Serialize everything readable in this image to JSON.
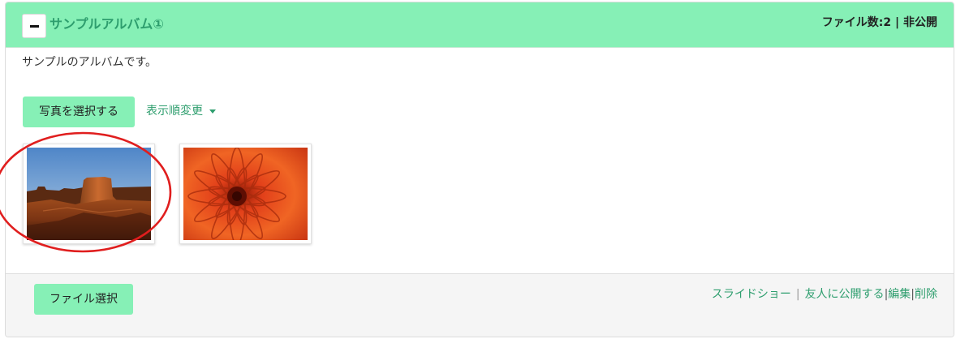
{
  "album": {
    "toggle_icon": "minus-icon",
    "title": "サンプルアルバム①",
    "meta": "ファイル数:2 | 非公開",
    "description": "サンプルのアルバムです。"
  },
  "toolbar": {
    "select_photo_label": "写真を選択する",
    "sort_label": "表示順変更",
    "sort_icon": "caret-down-icon"
  },
  "thumbnails": [
    {
      "subject": "desert-butte-landscape"
    },
    {
      "subject": "orange-chrysanthemum-flower"
    }
  ],
  "footer": {
    "file_select_label": "ファイル選択",
    "slideshow_label": "スライドショー",
    "separator_light": "|",
    "share_label": "友人に公開する",
    "separator": "|",
    "edit_label": "編集",
    "delete_label": "削除"
  },
  "colors": {
    "accent": "#86f0b6",
    "link": "#2e9e6e",
    "highlight": "#e01e1e"
  }
}
